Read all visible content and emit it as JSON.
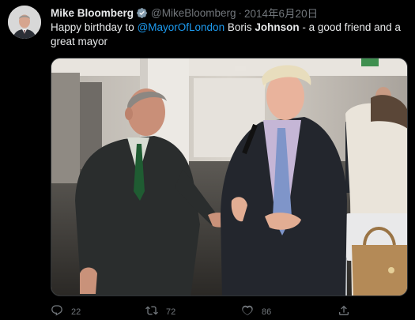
{
  "tweet": {
    "display_name": "Mike Bloomberg",
    "handle": "@MikeBloomberg",
    "separator": "·",
    "timestamp": "2014年6月20日",
    "text_parts": {
      "prefix": "Happy birthday to ",
      "mention": "@MayorOfLondon",
      "middle": " Boris ",
      "bold": "Johnson",
      "suffix": " - a good friend and a great mayor"
    }
  },
  "actions": {
    "reply_count": "22",
    "retweet_count": "72",
    "like_count": "86"
  },
  "colors": {
    "background": "#000000",
    "text": "#e7e9ea",
    "secondary": "#71767b",
    "link": "#1d9bf0",
    "verified": "#829aab"
  },
  "icons": {
    "verified": "verified-badge-icon",
    "reply": "reply-icon",
    "retweet": "retweet-icon",
    "like": "heart-icon",
    "share": "share-icon"
  }
}
